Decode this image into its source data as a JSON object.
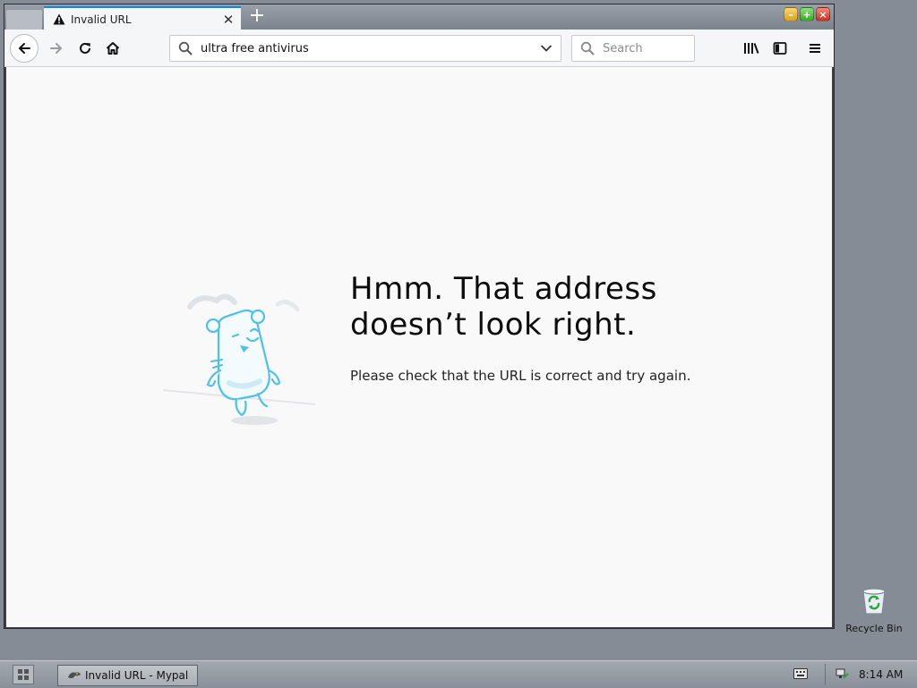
{
  "browser": {
    "tab": {
      "title": "Invalid URL",
      "close_label": "✕",
      "icon": "warning-icon"
    },
    "new_tab_label": "+",
    "window_controls": {
      "minimize": "–",
      "maximize": "+",
      "close": "×"
    },
    "nav": {
      "back_icon": "back-arrow-icon",
      "forward_icon": "forward-arrow-icon",
      "reload_icon": "reload-icon",
      "home_icon": "home-icon"
    },
    "urlbar": {
      "value": "ultra free antivirus"
    },
    "searchbar": {
      "placeholder": "Search"
    },
    "toolbar_icons": [
      "library-icon",
      "sidebar-icon",
      "menu-icon"
    ]
  },
  "error_page": {
    "title": "Hmm. That address doesn’t look right.",
    "description": "Please check that the URL is correct and try again."
  },
  "desktop": {
    "recycle_bin_label": "Recycle Bin"
  },
  "taskbar": {
    "task_label": "Invalid URL - Mypal",
    "clock": "8:14 AM"
  },
  "colors": {
    "desktop_bg": "#868c95",
    "tab_accent": "#0a84ff",
    "page_bg": "#f9f9fa",
    "mascot_blue": "#4ec0e9"
  }
}
